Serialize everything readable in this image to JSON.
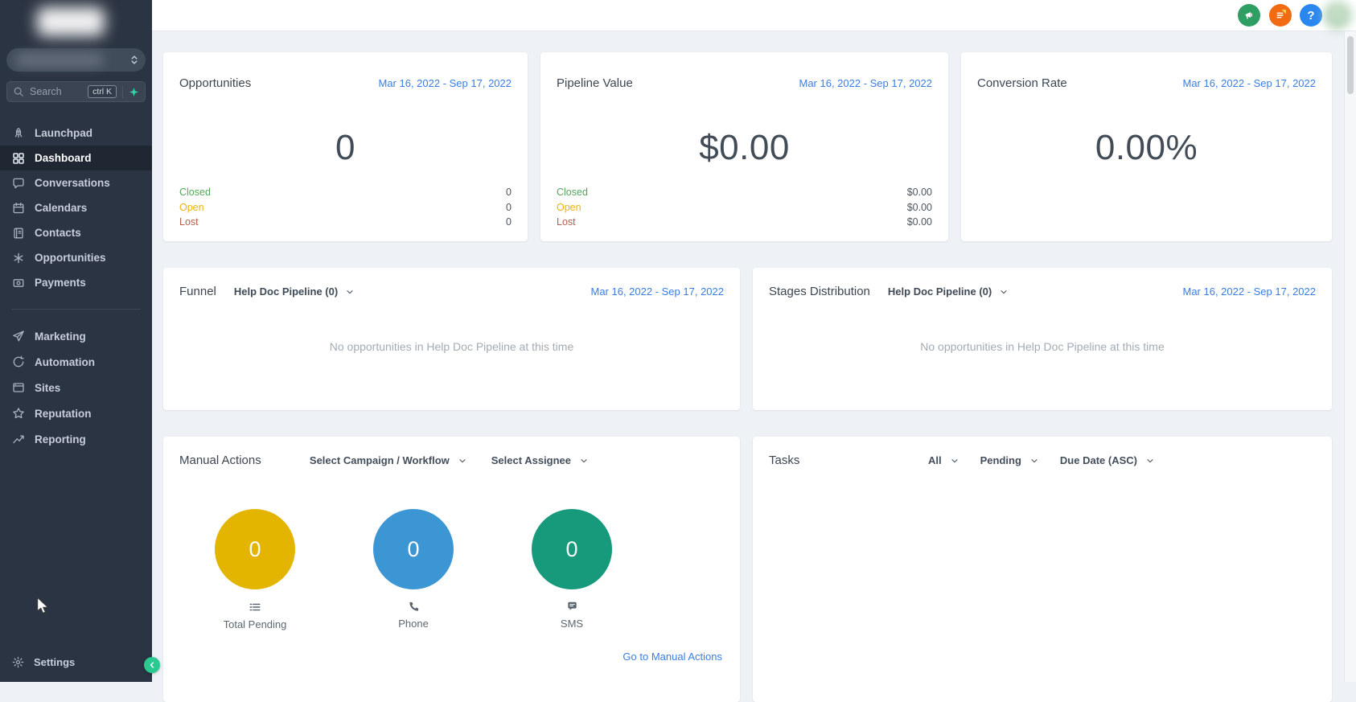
{
  "sidebar": {
    "search": {
      "placeholder": "Search",
      "shortcut": "ctrl K"
    },
    "nav": [
      {
        "label": "Launchpad",
        "icon": "launchpad-icon",
        "active": false
      },
      {
        "label": "Dashboard",
        "icon": "dashboard-icon",
        "active": true
      },
      {
        "label": "Conversations",
        "icon": "conversations-icon",
        "active": false
      },
      {
        "label": "Calendars",
        "icon": "calendars-icon",
        "active": false
      },
      {
        "label": "Contacts",
        "icon": "contacts-icon",
        "active": false
      },
      {
        "label": "Opportunities",
        "icon": "opportunities-icon",
        "active": false
      },
      {
        "label": "Payments",
        "icon": "payments-icon",
        "active": false
      }
    ],
    "nav_secondary": [
      {
        "label": "Marketing",
        "icon": "marketing-icon"
      },
      {
        "label": "Automation",
        "icon": "automation-icon"
      },
      {
        "label": "Sites",
        "icon": "sites-icon"
      },
      {
        "label": "Reputation",
        "icon": "reputation-icon"
      },
      {
        "label": "Reporting",
        "icon": "reporting-icon"
      }
    ],
    "settings_label": "Settings"
  },
  "topbar": {
    "icons": [
      "announcements-icon",
      "onboarding-checklist-icon",
      "help-icon"
    ],
    "help_glyph": "?"
  },
  "cards": {
    "opportunities": {
      "title": "Opportunities",
      "date_range": "Mar 16, 2022 - Sep 17, 2022",
      "value": "0",
      "legend": [
        {
          "label": "Closed",
          "value": "0",
          "color": "#55a55d"
        },
        {
          "label": "Open",
          "value": "0",
          "color": "#f0b30a"
        },
        {
          "label": "Lost",
          "value": "0",
          "color": "#b2604e"
        }
      ]
    },
    "pipeline_value": {
      "title": "Pipeline Value",
      "date_range": "Mar 16, 2022 - Sep 17, 2022",
      "value": "$0.00",
      "legend": [
        {
          "label": "Closed",
          "value": "$0.00",
          "color": "#55a55d"
        },
        {
          "label": "Open",
          "value": "$0.00",
          "color": "#f0b30a"
        },
        {
          "label": "Lost",
          "value": "$0.00",
          "color": "#b2604e"
        }
      ]
    },
    "conversion_rate": {
      "title": "Conversion Rate",
      "date_range": "Mar 16, 2022 - Sep 17, 2022",
      "value": "0.00%"
    },
    "funnel": {
      "title": "Funnel",
      "pipeline": "Help Doc Pipeline (0)",
      "date_range": "Mar 16, 2022 - Sep 17, 2022",
      "empty": "No opportunities in Help Doc Pipeline at this time"
    },
    "stages": {
      "title": "Stages Distribution",
      "pipeline": "Help Doc Pipeline (0)",
      "date_range": "Mar 16, 2022 - Sep 17, 2022",
      "empty": "No opportunities in Help Doc Pipeline at this time"
    },
    "manual_actions": {
      "title": "Manual Actions",
      "campaign_filter": "Select Campaign / Workflow",
      "assignee_filter": "Select Assignee",
      "stats": [
        {
          "value": "0",
          "label": "Total Pending",
          "color": "#e3b400",
          "icon": "list-icon"
        },
        {
          "value": "0",
          "label": "Phone",
          "color": "#3d96d4",
          "icon": "phone-icon"
        },
        {
          "value": "0",
          "label": "SMS",
          "color": "#17997c",
          "icon": "sms-icon"
        }
      ],
      "link": "Go to Manual Actions"
    },
    "tasks": {
      "title": "Tasks",
      "filters": [
        "All",
        "Pending",
        "Due Date (ASC)"
      ]
    }
  }
}
